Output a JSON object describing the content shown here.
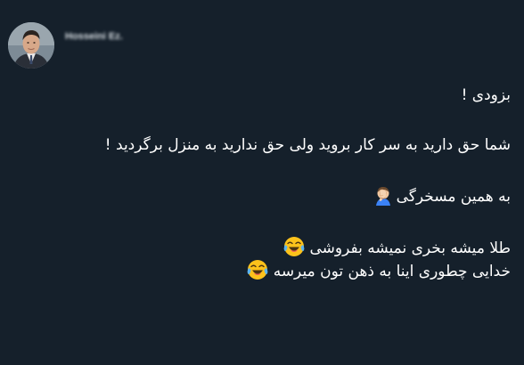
{
  "tweet": {
    "user_name": "Hosseini Ez.",
    "lines": [
      "بزودی !",
      "شما حق دارید به سر کار بروید ولی حق ندارید به منزل برگردید !",
      "به همین مسخرگی",
      "طلا میشه بخری نمیشه بفروشی",
      "خدایی چطوری اینا به ذهن تون میرسه"
    ],
    "emojis": [
      "man-facepalming-icon",
      "face-with-tears-of-joy-icon",
      "face-with-tears-of-joy-icon"
    ]
  },
  "colors": {
    "background": "#15202b",
    "text": "#ffffff",
    "name": "#d9dfe4"
  }
}
